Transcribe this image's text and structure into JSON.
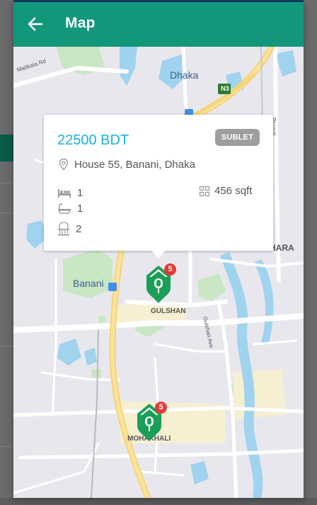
{
  "app": {
    "title": "Map"
  },
  "map": {
    "labels": {
      "dhaka": "Dhaka",
      "banani": "Banani",
      "gulshan": "GULSHAN",
      "mohakhali": "MOHAKHALI",
      "hara": "HARA",
      "n3": "N3",
      "matikata_rd": "Matikata Rd",
      "gulshan_ave": "Gulshan Ave",
      "progoti_sarani": "Progoti Sarani"
    },
    "markers": [
      {
        "count": "5"
      },
      {
        "count": "5"
      }
    ]
  },
  "popup": {
    "price": "22500 BDT",
    "badge": "SUBLET",
    "address": "House 55, Banani, Dhaka",
    "bedrooms": "1",
    "bathrooms": "1",
    "balconies": "2",
    "area": "456 sqft"
  },
  "colors": {
    "appbar": "#12977b",
    "price": "#1db3d6",
    "marker": "#1b9e57",
    "badge": "#9e9e9e"
  },
  "icons": {
    "back": "arrow-left-icon",
    "location": "location-pin-icon",
    "bed": "bed-icon",
    "bath": "bathtub-icon",
    "balcony": "balcony-icon",
    "area": "grid-area-icon",
    "marker": "house-marker-icon"
  }
}
